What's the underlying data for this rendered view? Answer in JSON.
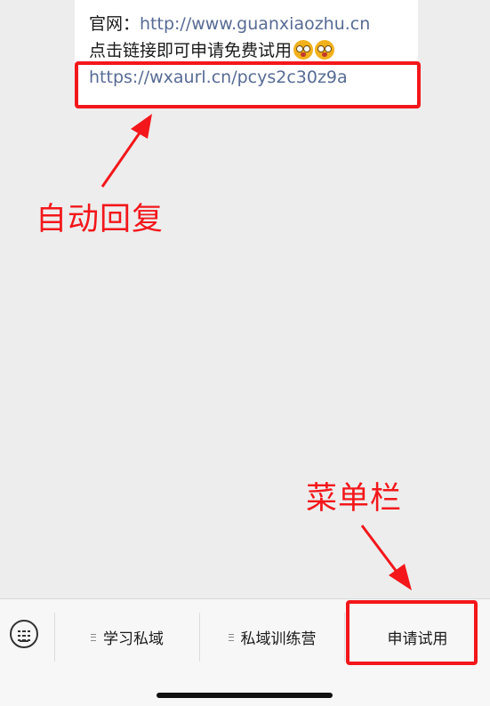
{
  "message": {
    "website_label": "官网：",
    "website_url": "http://www.guanxiaozhu.cn",
    "trial_text": "点击链接即可申请免费试用",
    "trial_link": "https://wxaurl.cn/pcys2c30z9a",
    "emoji": "drooling-face-emoji"
  },
  "annotations": {
    "auto_reply": "自动回复",
    "menu_bar": "菜单栏"
  },
  "menu": {
    "keyboard_icon": "keyboard-icon",
    "items": [
      {
        "label": "学习私域",
        "has_submenu": true
      },
      {
        "label": "私域训练营",
        "has_submenu": true
      },
      {
        "label": "申请试用",
        "has_submenu": false
      }
    ]
  },
  "colors": {
    "annotation": "#f3171b",
    "link": "#576b95",
    "background": "#ededed"
  }
}
